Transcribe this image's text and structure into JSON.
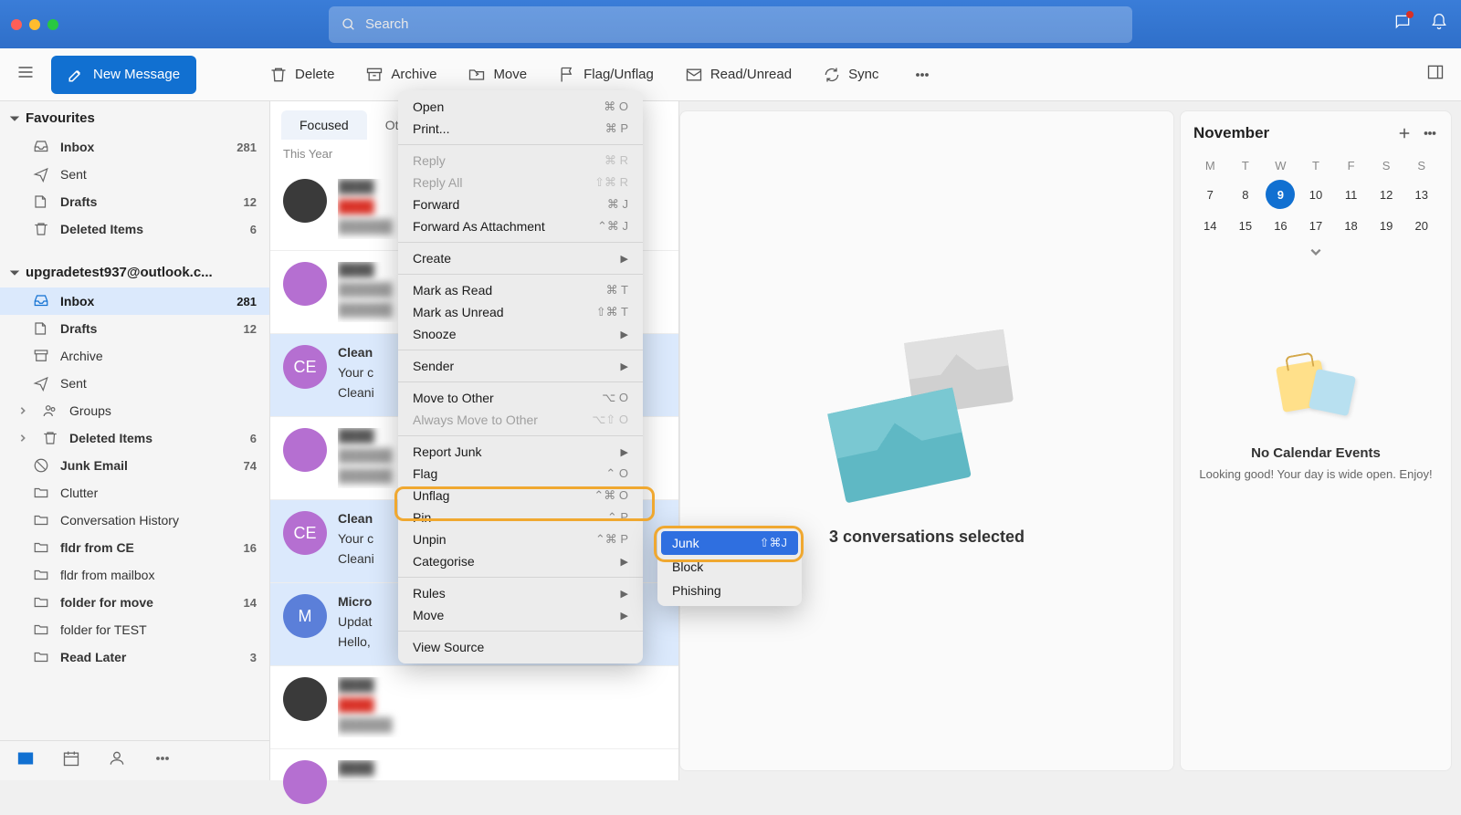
{
  "titlebar": {
    "search_placeholder": "Search"
  },
  "toolbar": {
    "new_message": "New Message",
    "delete": "Delete",
    "archive": "Archive",
    "move": "Move",
    "flag": "Flag/Unflag",
    "read": "Read/Unread",
    "sync": "Sync"
  },
  "sidebar": {
    "favourites_label": "Favourites",
    "account_label": "upgradetest937@outlook.c...",
    "fav": [
      {
        "name": "Inbox",
        "count": "281"
      },
      {
        "name": "Sent",
        "count": ""
      },
      {
        "name": "Drafts",
        "count": "12"
      },
      {
        "name": "Deleted Items",
        "count": "6"
      }
    ],
    "acct": [
      {
        "name": "Inbox",
        "count": "281"
      },
      {
        "name": "Drafts",
        "count": "12"
      },
      {
        "name": "Archive",
        "count": ""
      },
      {
        "name": "Sent",
        "count": ""
      },
      {
        "name": "Groups",
        "count": ""
      },
      {
        "name": "Deleted Items",
        "count": "6"
      },
      {
        "name": "Junk Email",
        "count": "74"
      },
      {
        "name": "Clutter",
        "count": ""
      },
      {
        "name": "Conversation History",
        "count": ""
      },
      {
        "name": "fldr from CE",
        "count": "16"
      },
      {
        "name": "fldr from mailbox",
        "count": ""
      },
      {
        "name": "folder for move",
        "count": "14"
      },
      {
        "name": "folder for TEST",
        "count": ""
      },
      {
        "name": "Read Later",
        "count": "3"
      }
    ]
  },
  "msglist": {
    "tab_focused": "Focused",
    "tab_other": "Other",
    "section": "This Year",
    "items": [
      {
        "avatar": "",
        "sender": "",
        "subject": "",
        "preview": ""
      },
      {
        "avatar": "",
        "sender": "",
        "subject": "",
        "preview": ""
      },
      {
        "avatar": "CE",
        "sender": "Clean",
        "subject": "Your c",
        "preview": "Cleani"
      },
      {
        "avatar": "",
        "sender": "",
        "subject": "",
        "preview": ""
      },
      {
        "avatar": "CE",
        "sender": "Clean",
        "subject": "Your c",
        "preview": "Cleani"
      },
      {
        "avatar": "M",
        "sender": "Micro",
        "subject": "Updat",
        "preview": "Hello,"
      },
      {
        "avatar": "",
        "sender": "",
        "subject": "",
        "preview": ""
      },
      {
        "avatar": "",
        "sender": "",
        "subject": "",
        "preview": ""
      }
    ]
  },
  "reading_pane": {
    "title": "3 conversations selected"
  },
  "calendar": {
    "month": "November",
    "dow": [
      "M",
      "T",
      "W",
      "T",
      "F",
      "S",
      "S"
    ],
    "rows": [
      [
        "7",
        "8",
        "9",
        "10",
        "11",
        "12",
        "13"
      ],
      [
        "14",
        "15",
        "16",
        "17",
        "18",
        "19",
        "20"
      ]
    ],
    "today": "9",
    "empty_title": "No Calendar Events",
    "empty_sub": "Looking good! Your day is wide open. Enjoy!"
  },
  "ctx": {
    "open": {
      "label": "Open",
      "shortcut": "⌘ O"
    },
    "print": {
      "label": "Print...",
      "shortcut": "⌘ P"
    },
    "reply": {
      "label": "Reply",
      "shortcut": "⌘ R"
    },
    "reply_all": {
      "label": "Reply All",
      "shortcut": "⇧⌘ R"
    },
    "forward": {
      "label": "Forward",
      "shortcut": "⌘ J"
    },
    "forward_att": {
      "label": "Forward As Attachment",
      "shortcut": "⌃⌘ J"
    },
    "create": {
      "label": "Create"
    },
    "mark_read": {
      "label": "Mark as Read",
      "shortcut": "⌘ T"
    },
    "mark_unread": {
      "label": "Mark as Unread",
      "shortcut": "⇧⌘ T"
    },
    "snooze": {
      "label": "Snooze"
    },
    "sender": {
      "label": "Sender"
    },
    "move_other": {
      "label": "Move to Other",
      "shortcut": "⌥ O"
    },
    "always_move": {
      "label": "Always Move to Other",
      "shortcut": "⌥⇧ O"
    },
    "report_junk": {
      "label": "Report Junk"
    },
    "flag": {
      "label": "Flag",
      "shortcut": "⌃ O"
    },
    "unflag": {
      "label": "Unflag",
      "shortcut": "⌃⌘ O"
    },
    "pin": {
      "label": "Pin",
      "shortcut": "⌃ P"
    },
    "unpin": {
      "label": "Unpin",
      "shortcut": "⌃⌘ P"
    },
    "categorise": {
      "label": "Categorise"
    },
    "rules": {
      "label": "Rules"
    },
    "move": {
      "label": "Move"
    },
    "view_source": {
      "label": "View Source"
    }
  },
  "submenu": {
    "junk": {
      "label": "Junk",
      "shortcut": "⇧⌘J"
    },
    "block": {
      "label": "Block"
    },
    "phishing": {
      "label": "Phishing"
    }
  }
}
